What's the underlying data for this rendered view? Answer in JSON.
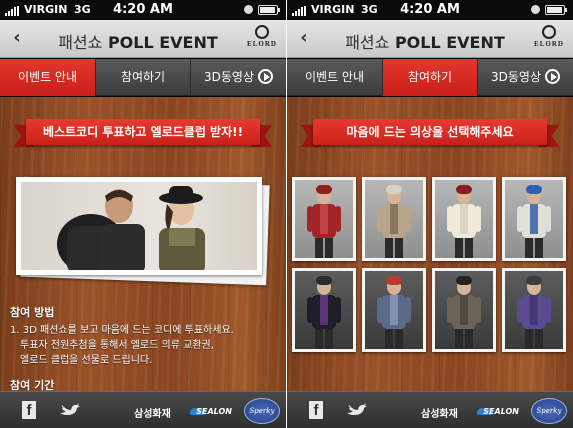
{
  "status": {
    "carrier": "VIRGIN",
    "network": "3G",
    "time": "4:20 AM"
  },
  "header": {
    "title_prefix": "패션쇼",
    "title_main": "POLL EVENT",
    "logo_text": "ELORD",
    "back_symbol": "‹"
  },
  "tabs": [
    "이벤트 안내",
    "참여하기",
    "3D동영상"
  ],
  "screens": [
    {
      "active_tab": 0,
      "banner": "베스트코디 투표하고 엘로드클럽 받자!!",
      "howto": {
        "heading": "참여 방법",
        "lines": [
          "1. 3D 패션쇼를 보고 마음에 드는 코디에 투표하세요.",
          "투표자 전원추첨을 통해서 엘로드 의류 교환권,",
          "엘로드 클럽을 선물로 드립니다."
        ]
      },
      "period_heading": "참여 기간"
    },
    {
      "active_tab": 1,
      "banner": "마음에 드는 의상을 선택해주세요",
      "outfits": [
        {
          "label": "outfit-1",
          "hat": "#8b1f1f",
          "top": "#a32525",
          "accent": "#c94a4a"
        },
        {
          "label": "outfit-2",
          "hat": "#d8d2c4",
          "top": "#b8a58a",
          "accent": "#7a6a55"
        },
        {
          "label": "outfit-3",
          "hat": "#8a1d24",
          "top": "#efe9dc",
          "accent": "#d8cfbd"
        },
        {
          "label": "outfit-4",
          "hat": "#2d5fb0",
          "top": "#dfe0d7",
          "accent": "#2a56a0"
        },
        {
          "label": "outfit-5",
          "hat": "#2b2b2b",
          "top": "#1e1e2a",
          "accent": "#6a3a8a"
        },
        {
          "label": "outfit-6",
          "hat": "#b83a2c",
          "top": "#5a6a88",
          "accent": "#8a9ab8"
        },
        {
          "label": "outfit-7",
          "hat": "#222",
          "top": "#6d6458",
          "accent": "#4a4138"
        },
        {
          "label": "outfit-8",
          "hat": "#3c3c3c",
          "top": "#5a4a90",
          "accent": "#3e3470"
        }
      ]
    }
  ],
  "footer": {
    "facebook": "f",
    "samsung": "삼성화재",
    "sealon": "SEALON",
    "badge": "Sperky"
  },
  "colors": {
    "active_tab": "#d92b22",
    "ribbon": "#d42a22",
    "wood": "#8f4a22"
  }
}
